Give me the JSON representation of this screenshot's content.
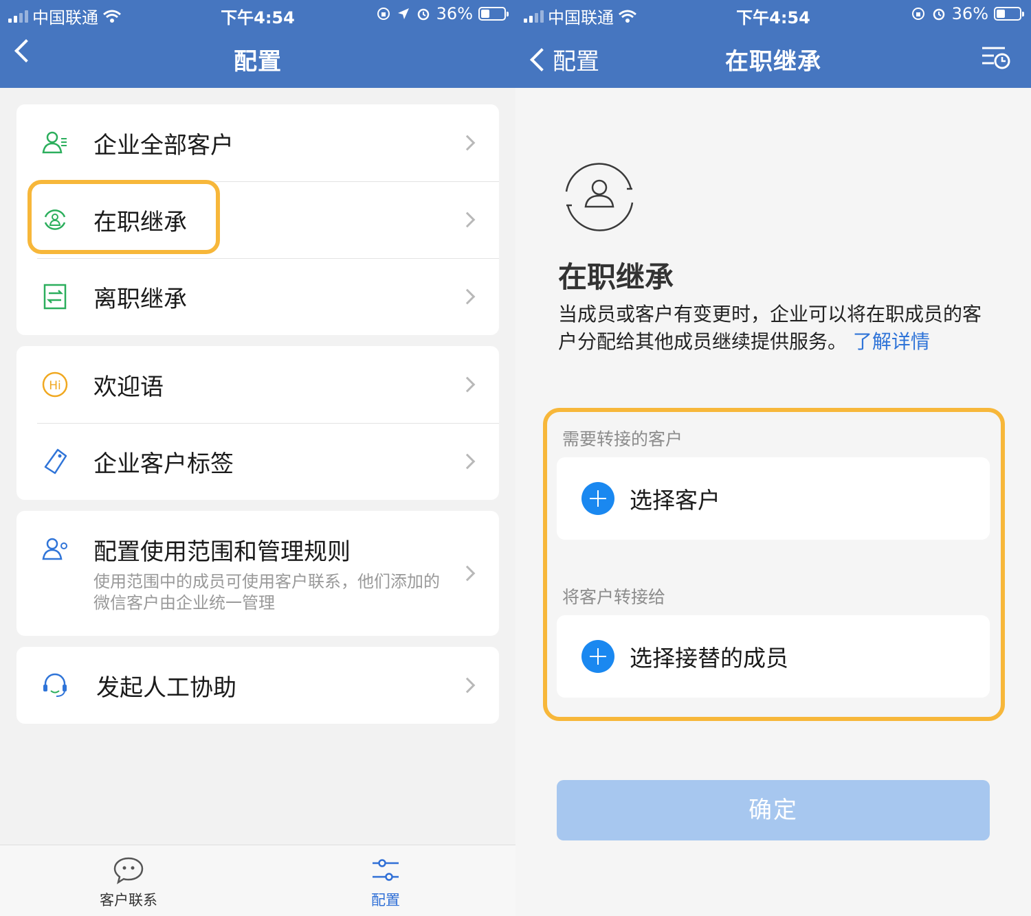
{
  "status_bar": {
    "carrier": "中国联通",
    "time": "下午4:54",
    "battery": "36%",
    "battery_level": 0.36
  },
  "left_screen": {
    "nav_title": "配置",
    "groups": [
      {
        "items": [
          {
            "label": "企业全部客户",
            "icon": "customer-list-icon"
          },
          {
            "label": "在职继承",
            "icon": "onjob-inherit-icon",
            "highlighted": true
          },
          {
            "label": "离职继承",
            "icon": "resign-transfer-icon"
          }
        ]
      },
      {
        "items": [
          {
            "label": "欢迎语",
            "icon": "hi-icon"
          },
          {
            "label": "企业客户标签",
            "icon": "tag-icon"
          }
        ]
      },
      {
        "items": [
          {
            "label": "配置使用范围和管理规则",
            "sublabel": "使用范围中的成员可使用客户联系，他们添加的微信客户由企业统一管理",
            "icon": "member-settings-icon"
          }
        ]
      },
      {
        "items": [
          {
            "label": "发起人工协助",
            "icon": "headset-icon"
          }
        ]
      }
    ],
    "tabs": [
      {
        "label": "客户联系",
        "icon": "chat-bubble-icon",
        "active": false
      },
      {
        "label": "配置",
        "icon": "sliders-icon",
        "active": true
      }
    ]
  },
  "right_screen": {
    "back_label": "配置",
    "nav_title": "在职继承",
    "hero_title": "在职继承",
    "description": "当成员或客户有变更时，企业可以将在职成员的客户分配给其他成员继续提供服务。",
    "link_text": "了解详情",
    "section1_label": "需要转接的客户",
    "pick_customer": "选择客户",
    "section2_label": "将客户转接给",
    "pick_member": "选择接替的成员",
    "confirm_label": "确定"
  },
  "colors": {
    "nav_blue": "#4676c0",
    "highlight": "#f7b73a",
    "green_icon": "#2bae5c",
    "blue_icon": "#2f74d8",
    "plus_blue": "#1a88f0",
    "confirm_disabled": "#a7c7ef"
  }
}
